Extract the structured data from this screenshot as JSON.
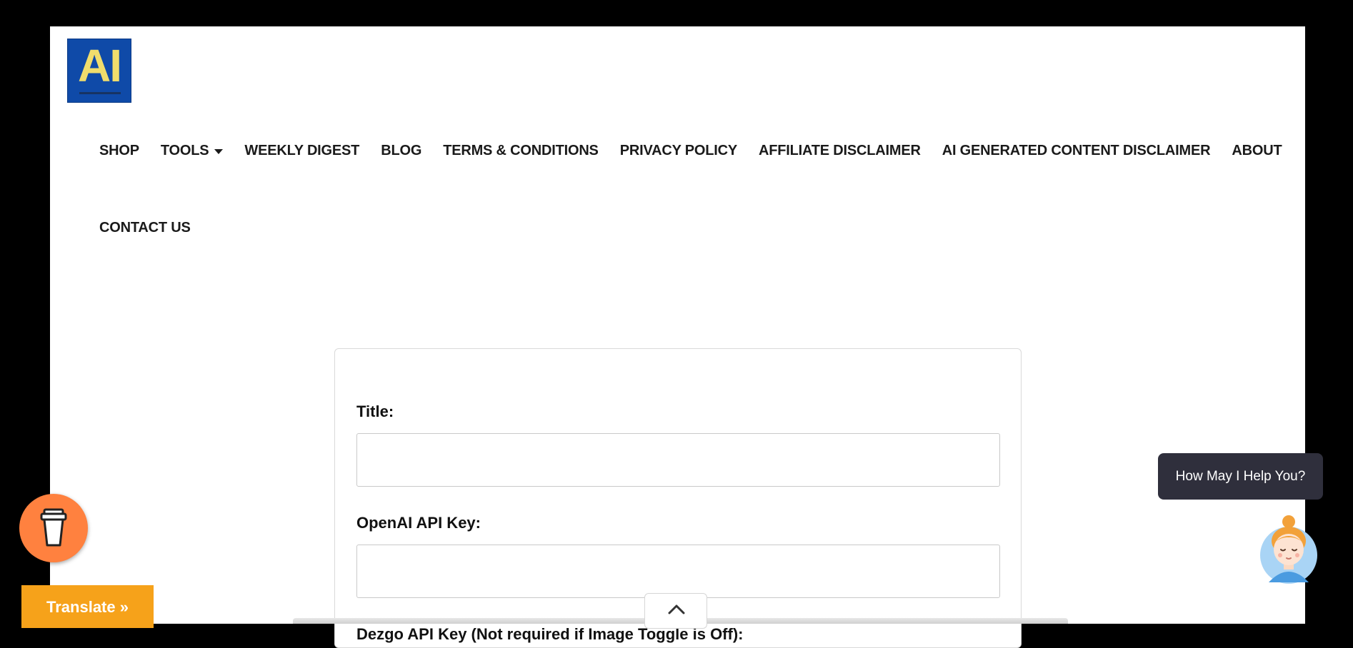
{
  "logo": {
    "text": "AI",
    "icon": "ai-logo-icon"
  },
  "nav": {
    "row1": [
      "SHOP",
      "TOOLS",
      "WEEKLY DIGEST",
      "BLOG",
      "TERMS & CONDITIONS",
      "PRIVACY POLICY",
      "AFFILIATE DISCLAIMER",
      "AI GENERATED CONTENT DISCLAIMER",
      "ABOUT"
    ],
    "row2": [
      "CONTACT US"
    ],
    "dropdown_icon": "caret-down-icon"
  },
  "form": {
    "title_label": "Title:",
    "title_value": "",
    "openai_label": "OpenAI API Key:",
    "openai_value": "",
    "dezgo_label": "Dezgo API Key (Not required if Image Toggle is Off):"
  },
  "scroll_top": {
    "icon": "chevron-up-icon"
  },
  "buy_coffee": {
    "icon": "coffee-cup-icon"
  },
  "translate": {
    "label": "Translate »"
  },
  "chat": {
    "prompt": "How May I Help You?",
    "icon": "assistant-avatar-icon"
  },
  "colors": {
    "background": "#000000",
    "logo_bg": "#0f4aa8",
    "logo_text": "#f0dd6c",
    "coffee": "#ff813f",
    "translate": "#f6a21a",
    "chat_bubble": "#2f2f3c"
  }
}
